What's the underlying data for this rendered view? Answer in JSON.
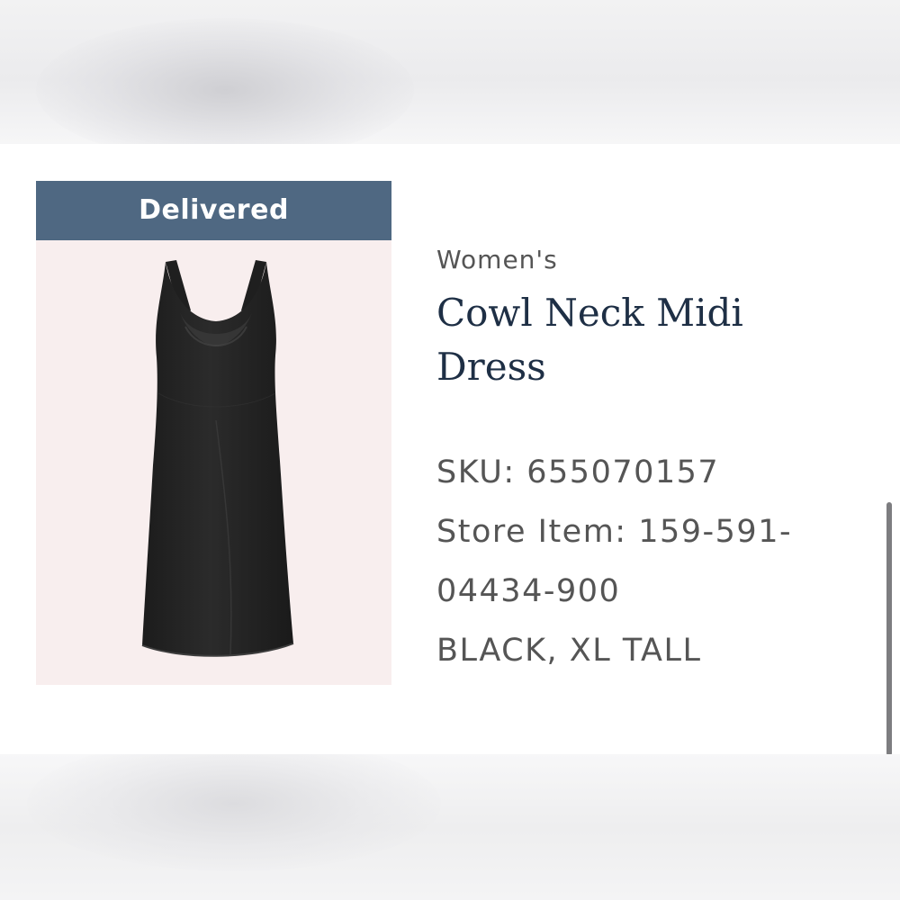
{
  "order_item": {
    "status": "Delivered",
    "category": "Women's",
    "name": "Cowl Neck Midi Dress",
    "sku_line": "SKU: 655070157",
    "store_item_line_1": "Store Item: 159-591-",
    "store_item_line_2": "04434-900",
    "variant": "BLACK, XL TALL"
  },
  "colors": {
    "status_banner": "#4f6882",
    "product_name": "#1e2f45",
    "meta_text": "#555555",
    "tile_background": "#f8eeee",
    "dress": "#262626"
  },
  "icons": {
    "product_image": "black-midi-dress-image"
  }
}
